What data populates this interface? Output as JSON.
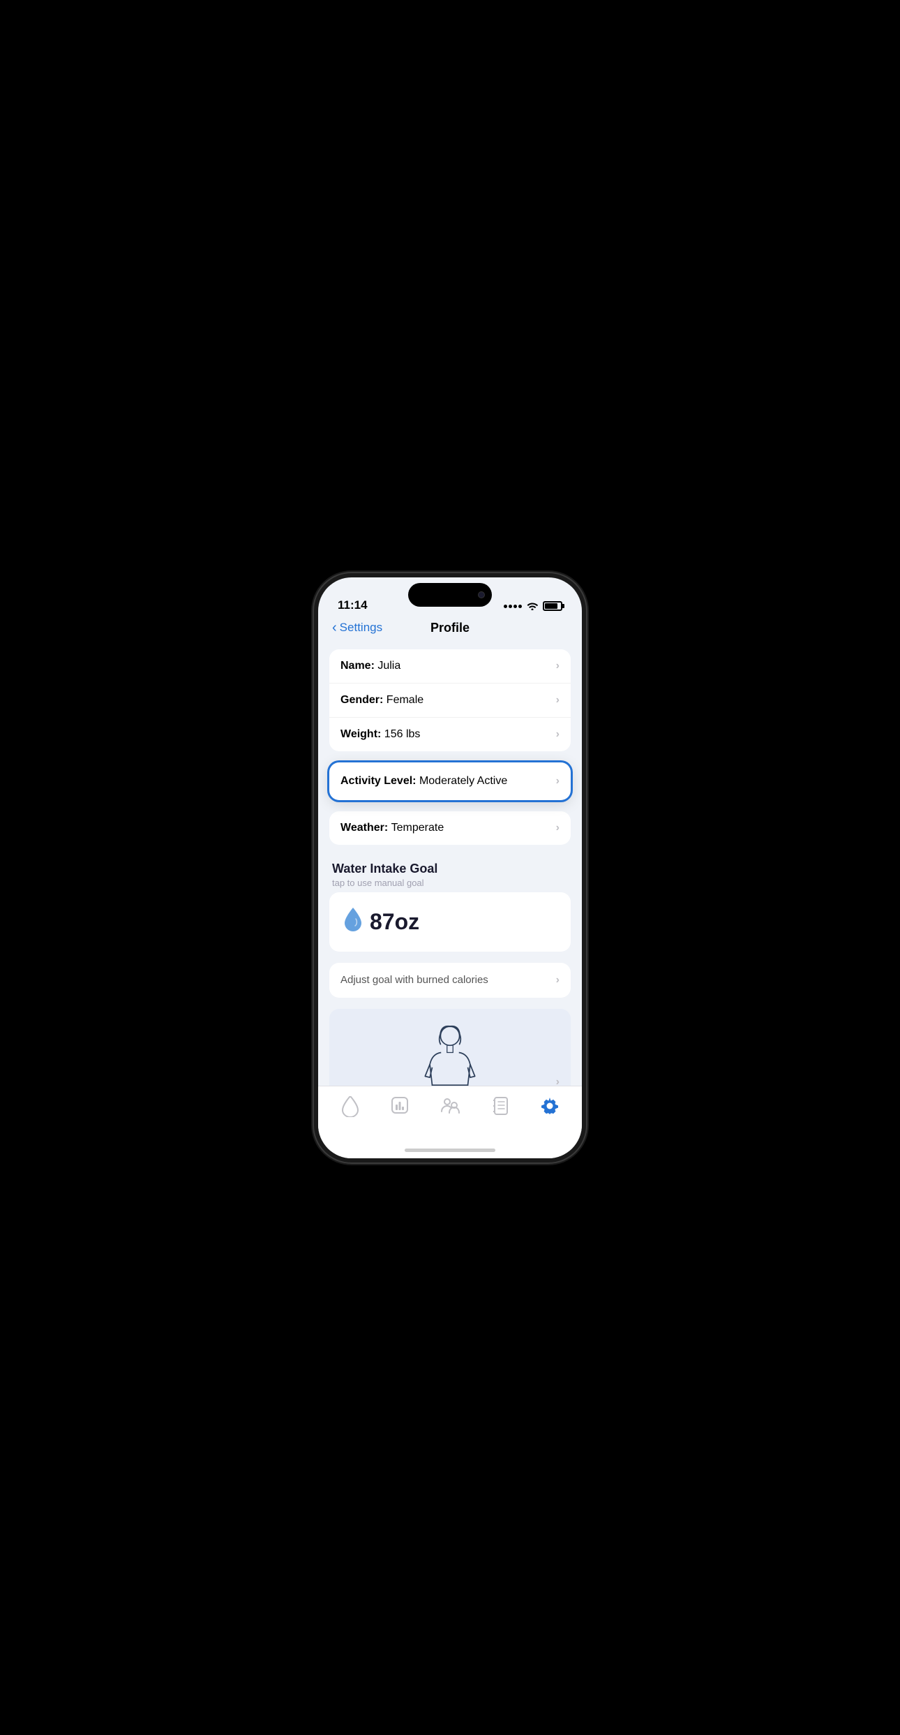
{
  "status_bar": {
    "time": "11:14",
    "signal": "dots",
    "wifi": "wifi",
    "battery": "battery"
  },
  "navigation": {
    "back_label": "Settings",
    "title": "Profile"
  },
  "profile_rows": [
    {
      "label": "Name:",
      "value": "Julia"
    },
    {
      "label": "Gender:",
      "value": "Female"
    },
    {
      "label": "Weight:",
      "value": "156 lbs"
    }
  ],
  "activity_level": {
    "label": "Activity Level:",
    "value": "Moderately Active"
  },
  "weather_row": {
    "label": "Weather:",
    "value": "Temperate"
  },
  "water_intake_section": {
    "title": "Water Intake Goal",
    "subtitle": "tap to use manual goal",
    "amount": "87oz",
    "drop_icon": "💧"
  },
  "adjust_goal": {
    "label": "Adjust goal with burned calories"
  },
  "tab_bar": {
    "items": [
      {
        "name": "water",
        "icon": "drop",
        "active": false
      },
      {
        "name": "stats",
        "icon": "chart",
        "active": false
      },
      {
        "name": "profile",
        "icon": "person",
        "active": false
      },
      {
        "name": "journal",
        "icon": "book",
        "active": false
      },
      {
        "name": "settings",
        "icon": "gear",
        "active": true
      }
    ]
  }
}
